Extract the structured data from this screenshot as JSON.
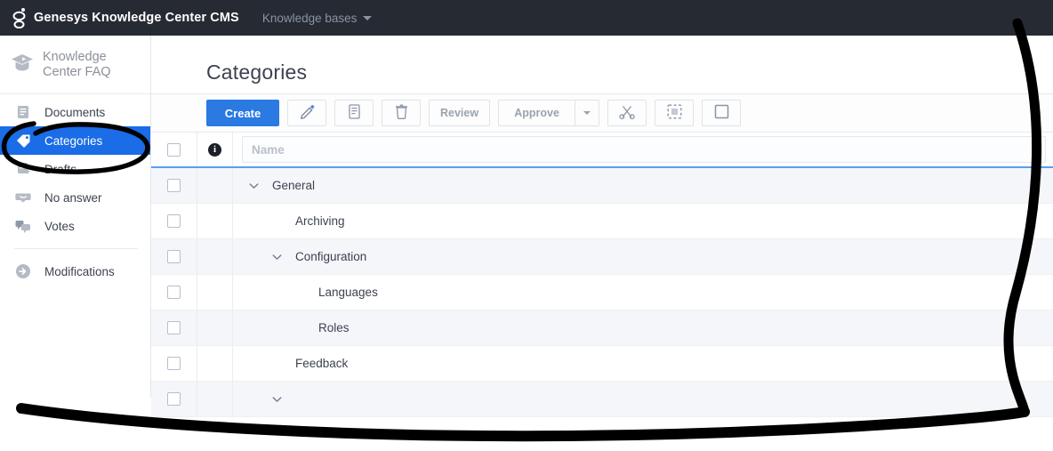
{
  "topbar": {
    "logo_icon": "genesys-logo-icon",
    "app_title": "Genesys Knowledge Center CMS",
    "kb_menu_label": "Knowledge bases",
    "kb_menu_caret_icon": "chevron-down-icon",
    "bg_color": "#262b33"
  },
  "sidebar": {
    "kb_logo_icon": "graduation-cap-icon",
    "kb_name_line1": "Knowledge",
    "kb_name_line2": "Center FAQ",
    "kb_name": "Knowledge Center FAQ",
    "active_color": "#1a6ce7",
    "items": [
      {
        "label": "Documents",
        "icon": "document-icon",
        "active": false
      },
      {
        "label": "Categories",
        "icon": "tag-icon",
        "active": true
      },
      {
        "label": "Drafts",
        "icon": "document-add-icon",
        "active": false
      },
      {
        "label": "No answer",
        "icon": "speech-bubble-icon",
        "active": false
      },
      {
        "label": "Votes",
        "icon": "votes-icon",
        "active": false
      },
      {
        "label": "Modifications",
        "icon": "arrow-circle-icon",
        "active": false
      }
    ]
  },
  "main": {
    "page_title": "Categories",
    "toolbar": {
      "create_label": "Create",
      "edit_icon": "pencil-icon",
      "copy_doc_icon": "document-copy-icon",
      "delete_icon": "trash-icon",
      "review_label": "Review",
      "approve_label": "Approve",
      "approve_caret_icon": "chevron-down-icon",
      "cut_icon": "scissors-icon",
      "paste_icon": "paste-dashed-square-icon",
      "copy_icon": "copy-square-icon",
      "primary_color": "#2a7ae2"
    },
    "table": {
      "header": {
        "select_all_icon": "checkbox-icon",
        "info_icon": "info-badge-icon",
        "name_placeholder": "Name",
        "name_value": "",
        "underline_color": "#58a0ee"
      },
      "rows": [
        {
          "name": "General",
          "indent": 0,
          "expandable": true,
          "expanded": true,
          "checked": false,
          "alt": true
        },
        {
          "name": "Archiving",
          "indent": 1,
          "expandable": false,
          "expanded": false,
          "checked": false,
          "alt": false
        },
        {
          "name": "Configuration",
          "indent": 1,
          "expandable": true,
          "expanded": true,
          "checked": false,
          "alt": true
        },
        {
          "name": "Languages",
          "indent": 2,
          "expandable": false,
          "expanded": false,
          "checked": false,
          "alt": false
        },
        {
          "name": "Roles",
          "indent": 2,
          "expandable": false,
          "expanded": false,
          "checked": false,
          "alt": true
        },
        {
          "name": "Feedback",
          "indent": 1,
          "expandable": false,
          "expanded": false,
          "checked": false,
          "alt": false
        },
        {
          "name": "",
          "indent": 1,
          "expandable": true,
          "expanded": true,
          "checked": false,
          "alt": true
        }
      ]
    }
  },
  "annotations": {
    "highlight_ellipse": "hand-drawn-ellipse-around-categories",
    "frame_curve": "hand-drawn-black-border-right-and-bottom",
    "ink_color": "#000000"
  }
}
